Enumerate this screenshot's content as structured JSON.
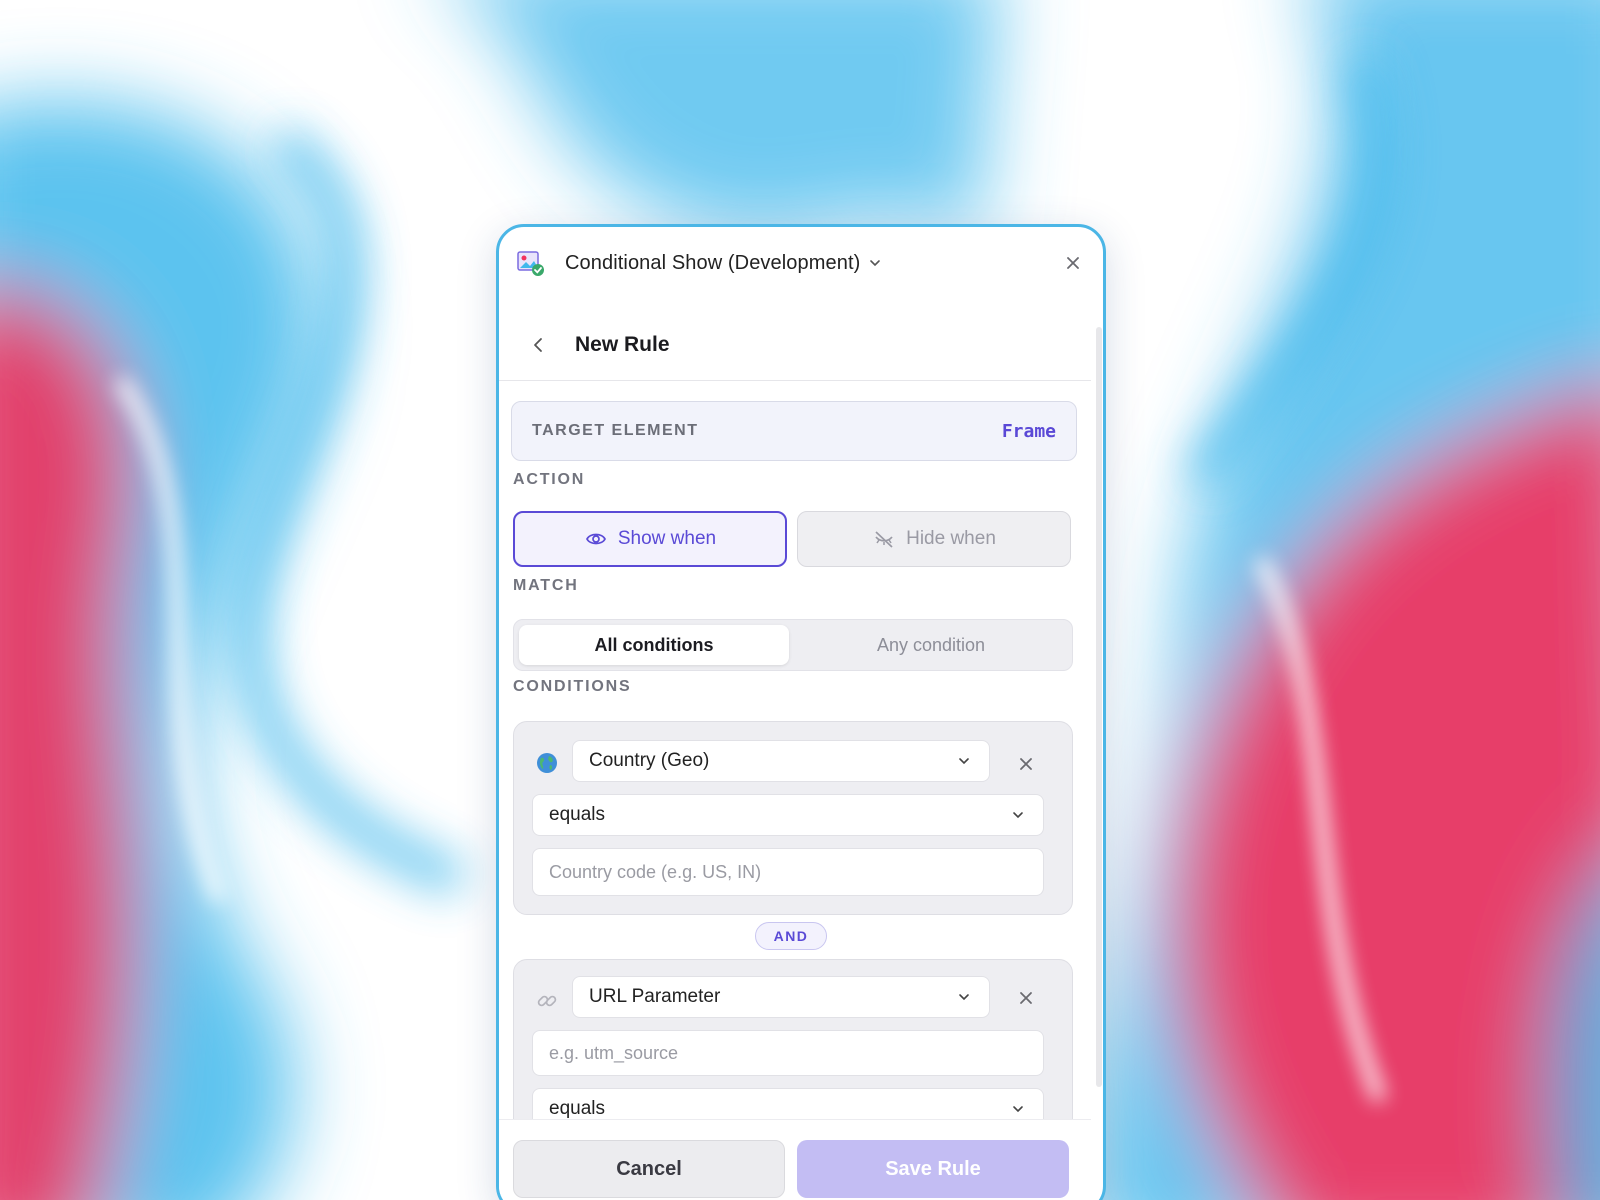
{
  "window": {
    "title": "Conditional Show (Development)",
    "app_icon": "app-logo-icon"
  },
  "header": {
    "title": "New Rule"
  },
  "target": {
    "label": "TARGET ELEMENT",
    "value": "Frame"
  },
  "action": {
    "label": "ACTION",
    "show_label": "Show when",
    "hide_label": "Hide when",
    "selected": "Show when"
  },
  "match": {
    "label": "MATCH",
    "options": [
      "All conditions",
      "Any condition"
    ],
    "selected": "All conditions"
  },
  "conditions": {
    "label": "CONDITIONS",
    "joiner": "AND",
    "items": [
      {
        "icon": "globe-icon",
        "type": "Country (Geo)",
        "operator": "equals",
        "value_placeholder": "Country code (e.g. US, IN)"
      },
      {
        "icon": "link-icon",
        "type": "URL Parameter",
        "param_placeholder": "e.g. utm_source",
        "operator": "equals"
      }
    ]
  },
  "footer": {
    "cancel_label": "Cancel",
    "save_label": "Save Rule"
  },
  "colors": {
    "accent": "#5a4ad6",
    "panel_border": "#4bb6e6",
    "save_disabled": "#c3bdf3",
    "bg_blue": "#41b8ec",
    "bg_pink": "#f2335e"
  }
}
